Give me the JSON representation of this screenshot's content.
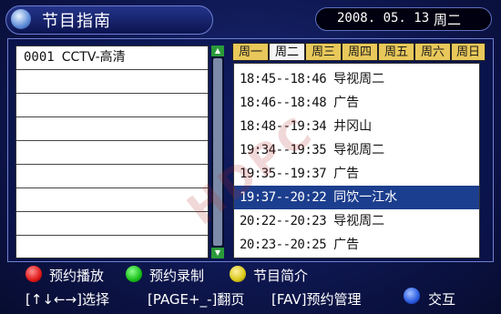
{
  "header": {
    "title": "节目指南",
    "date": "2008. 05. 13",
    "weekday": "周二"
  },
  "channels": [
    {
      "number": "0001",
      "name": "CCTV-高清"
    },
    {
      "number": "",
      "name": ""
    },
    {
      "number": "",
      "name": ""
    },
    {
      "number": "",
      "name": ""
    },
    {
      "number": "",
      "name": ""
    },
    {
      "number": "",
      "name": ""
    },
    {
      "number": "",
      "name": ""
    },
    {
      "number": "",
      "name": ""
    },
    {
      "number": "",
      "name": ""
    }
  ],
  "weekday_tabs": [
    "周一",
    "周二",
    "周三",
    "周四",
    "周五",
    "周六",
    "周日"
  ],
  "selected_tab": "周二",
  "programs": [
    {
      "time": "18:45--18:46",
      "title": "导视周二",
      "selected": false
    },
    {
      "time": "18:46--18:48",
      "title": "广告",
      "selected": false
    },
    {
      "time": "18:48--19:34",
      "title": "井冈山",
      "selected": false
    },
    {
      "time": "19:34--19:35",
      "title": "导视周二",
      "selected": false
    },
    {
      "time": "19:35--19:37",
      "title": "广告",
      "selected": false
    },
    {
      "time": "19:37--20:22",
      "title": "同饮一江水",
      "selected": true
    },
    {
      "time": "20:22--20:23",
      "title": "导视周二",
      "selected": false
    },
    {
      "time": "20:23--20:25",
      "title": "广告",
      "selected": false
    }
  ],
  "legend": {
    "red": "预约播放",
    "green": "预约录制",
    "yellow": "节目简介",
    "navigate": "[↑↓←→]选择",
    "page": "[PAGE+_-]翻页",
    "fav": "[FAV]预约管理",
    "blue": "交互"
  },
  "watermark": "HDPC",
  "colors": {
    "background": "#0e1750",
    "tab": "#e8c85a",
    "selected_row": "#1c3e8e",
    "scroll_arrow": "#2a9a3a"
  }
}
